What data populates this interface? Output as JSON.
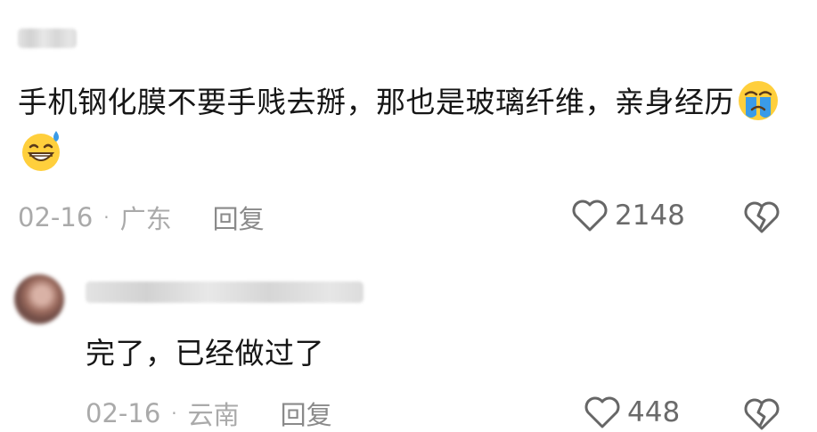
{
  "comments": [
    {
      "username": "用户",
      "text": "手机钢化膜不要手贱去掰，那也是玻璃纤维，亲身经历",
      "emojis": [
        "crying-face-emoji",
        "grinning-sweat-emoji"
      ],
      "date": "02-16",
      "location": "广东",
      "reply_label": "回复",
      "likes": "2148",
      "icons": {
        "like": "heart-icon",
        "dislike": "broken-heart-icon"
      }
    },
    {
      "username": "用户",
      "text": "完了，已经做过了",
      "date": "02-16",
      "location": "云南",
      "reply_label": "回复",
      "likes": "448",
      "icons": {
        "like": "heart-icon",
        "dislike": "broken-heart-icon"
      }
    }
  ],
  "separator": "·",
  "colors": {
    "text": "#161616",
    "meta": "#aaaaaa",
    "icon_stroke": "#666666",
    "emoji_face": "#ffcf3c",
    "tears": "#3a9be8"
  }
}
